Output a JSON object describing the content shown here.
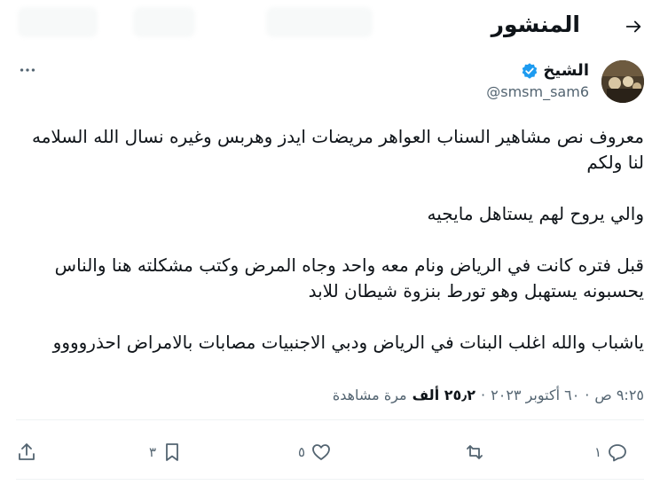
{
  "header": {
    "title": "المنشور"
  },
  "author": {
    "name": "الشيخ",
    "handle": "@smsm_sam6"
  },
  "post": {
    "lines": [
      "معروف نص مشاهير السناب العواهر مريضات ايدز وهربس وغيره نسال الله السلامه لنا ولكم",
      "والي يروح لهم يستاهل مايجيه",
      "قبل فتره كانت في الرياض ونام معه واحد وجاه المرض وكتب مشكلته هنا والناس يحسبونه يستهبل وهو تورط بنزوة شيطان للابد",
      "ياشباب والله اغلب البنات في الرياض ودبي الاجنبيات مصابات بالامراض احذروووو"
    ]
  },
  "meta": {
    "time": "٩:٢٥ ص",
    "date": "٦٠ أكتوبر ٢٠٢٣",
    "separator": "·",
    "views_count": "٢٥٫٢ ألف",
    "views_label": "مرة مشاهدة"
  },
  "actions": {
    "reply_count": "١",
    "repost_count": "",
    "like_count": "٥",
    "bookmark_count": "٣"
  },
  "icons": {
    "back": "back-arrow-icon",
    "verified": "verified-badge-icon",
    "more": "more-icon",
    "reply": "reply-icon",
    "repost": "repost-icon",
    "like": "like-icon",
    "bookmark": "bookmark-icon",
    "share": "share-icon"
  },
  "colors": {
    "verified": "#1d9bf0",
    "text": "#0f1419",
    "muted": "#536471"
  }
}
